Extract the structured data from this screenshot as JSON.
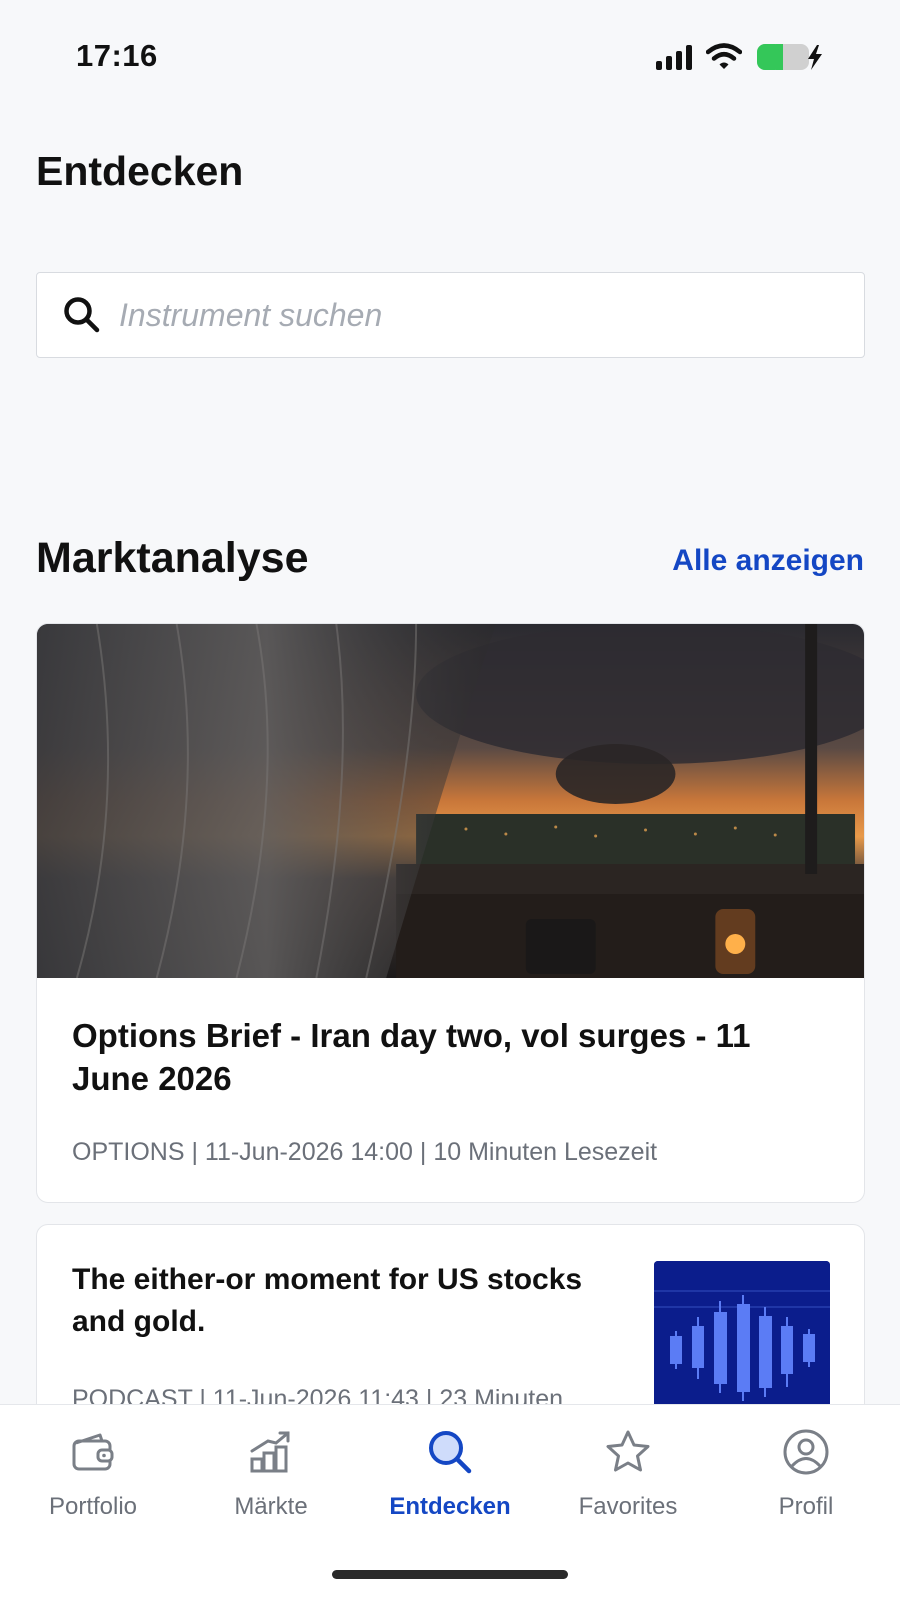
{
  "status_bar": {
    "time": "17:16",
    "battery_color": "#34c759"
  },
  "header": {
    "title": "Entdecken"
  },
  "search": {
    "placeholder": "Instrument suchen",
    "value": ""
  },
  "section": {
    "title": "Marktanalyse",
    "link_label": "Alle anzeigen",
    "accent_color": "#1447c4"
  },
  "cards": [
    {
      "title": "Options Brief - Iran day two, vol surges - 11 June 2026",
      "meta": "OPTIONS | 11-Jun-2026 14:00 | 10 Minuten Lesezeit",
      "image": "window-storm-photo"
    },
    {
      "title": "The either-or moment for US stocks and gold.",
      "meta": "PODCAST | 11-Jun-2026 11:43 | 23 Minuten",
      "image": "candlestick-thumbnail"
    }
  ],
  "bottom_nav": {
    "items": [
      {
        "label": "Portfolio",
        "icon": "wallet-icon",
        "active": false
      },
      {
        "label": "Märkte",
        "icon": "chart-growth-icon",
        "active": false
      },
      {
        "label": "Entdecken",
        "icon": "search-icon",
        "active": true
      },
      {
        "label": "Favorites",
        "icon": "star-icon",
        "active": false
      },
      {
        "label": "Profil",
        "icon": "profile-icon",
        "active": false
      }
    ]
  }
}
